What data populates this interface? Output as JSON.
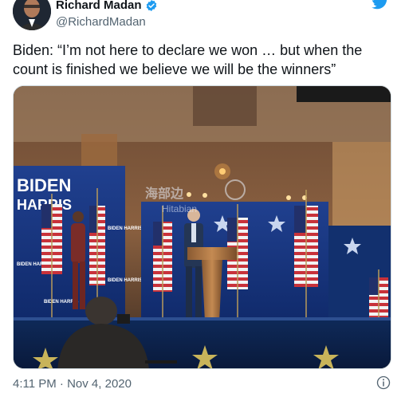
{
  "author": {
    "display_name": "Richard Madan",
    "handle": "@RichardMadan",
    "verified_icon": "verified-badge-icon",
    "avatar_icon": "avatar"
  },
  "brand": {
    "icon": "twitter-bird-icon",
    "color": "#1d9bf0"
  },
  "tweet": {
    "text_line1": "Biden: “I’m not here to declare we won … but when the",
    "text_line2": "count is finished we believe we will be the winners”"
  },
  "media": {
    "banner_line1": "BIDEN",
    "banner_line2": "HARRIS",
    "podium_line1": "BIDEN",
    "podium_line2": "HARRIS",
    "small_sign": "BIDEN HARRIS",
    "watermark_cn": "海部边",
    "watermark_en": "Hitabian"
  },
  "footer": {
    "timestamp": "4:11 PM · Nov 4, 2020",
    "info_icon": "info-icon"
  },
  "colors": {
    "text": "#0f1419",
    "secondary": "#536471",
    "accent": "#1d9bf0",
    "stage_blue": "#1f3f8f"
  }
}
